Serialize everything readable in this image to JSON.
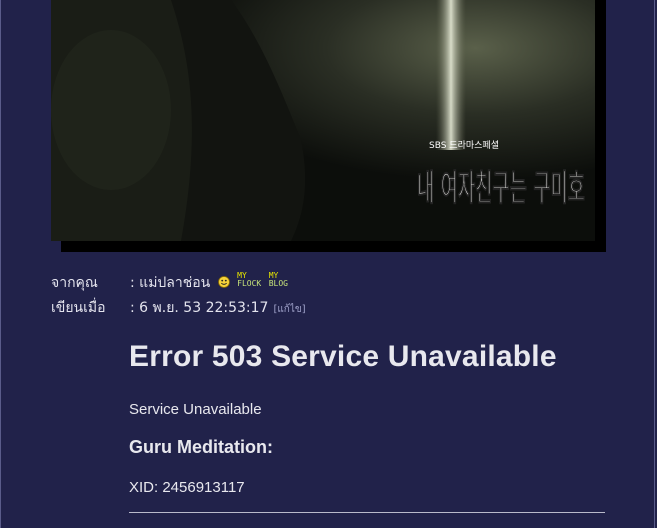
{
  "image": {
    "logo_text": "내 여자친구는 구미호",
    "broadcaster": "SBS 드라마스페셜"
  },
  "post_meta": {
    "from_label": "จากคุณ",
    "from_value": ": แม่ปลาช่อน",
    "my_flock_top": "MY",
    "my_flock_bottom": "FLOCK",
    "my_blog_top": "MY",
    "my_blog_bottom": "BLOG",
    "written_label": "เขียนเมื่อ",
    "written_value": ": 6 พ.ย. 53 22:53:17",
    "edit_label": "[แก้ไข]"
  },
  "error": {
    "title": "Error 503 Service Unavailable",
    "message": "Service Unavailable",
    "guru_heading": "Guru Meditation:",
    "xid": "XID: 2456913117"
  }
}
